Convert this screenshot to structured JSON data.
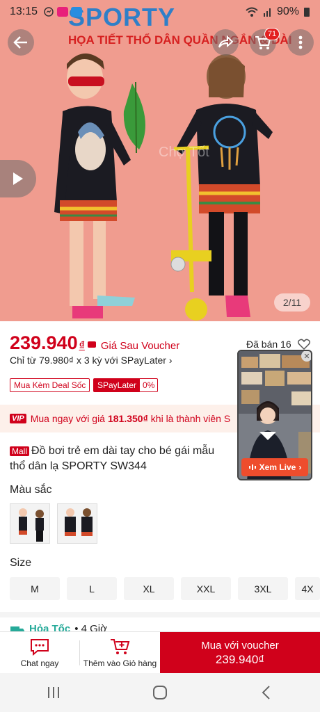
{
  "status_bar": {
    "time": "13:15",
    "battery": "90%"
  },
  "brand": "SPORTY",
  "banner_text": "HỌA TIẾT THỔ DÂN QUẦN NGẮN & DÀI",
  "cart_badge": "71",
  "image_counter": "2/11",
  "price": {
    "amount": "239.940",
    "currency": "₫",
    "voucher_label": "Giá Sau Voucher"
  },
  "sold": "Đã bán 16",
  "installment": "Chỉ từ 79.980₫ x 3 kỳ với SPayLater",
  "tags": {
    "deal": "Mua Kèm Deal Sốc",
    "spaylater": "SPayLater",
    "rate": "0%"
  },
  "vip": {
    "badge": "VIP",
    "prefix": "Mua ngay với giá",
    "price": "181.350₫",
    "suffix": "khi là thành viên S"
  },
  "product": {
    "mall": "Mall",
    "title": "Đồ bơi trẻ em dài tay cho bé gái mẫu thổ dân lạ SPORTY SW344"
  },
  "color_label": "Màu sắc",
  "size_label": "Size",
  "sizes": [
    "M",
    "L",
    "XL",
    "XXL",
    "3XL",
    "4X"
  ],
  "shipping": {
    "label": "Hỏa Tốc",
    "eta": "• 4 Giờ"
  },
  "live": {
    "button": "Xem Live"
  },
  "bottom": {
    "chat": "Chat ngay",
    "cart": "Thêm vào Giỏ hàng",
    "buy_label": "Mua với voucher",
    "buy_price": "239.940₫"
  },
  "colors": {
    "accent": "#d0011b",
    "hero_bg": "#f09c8f",
    "brand_blue": "#2f7fc8"
  }
}
